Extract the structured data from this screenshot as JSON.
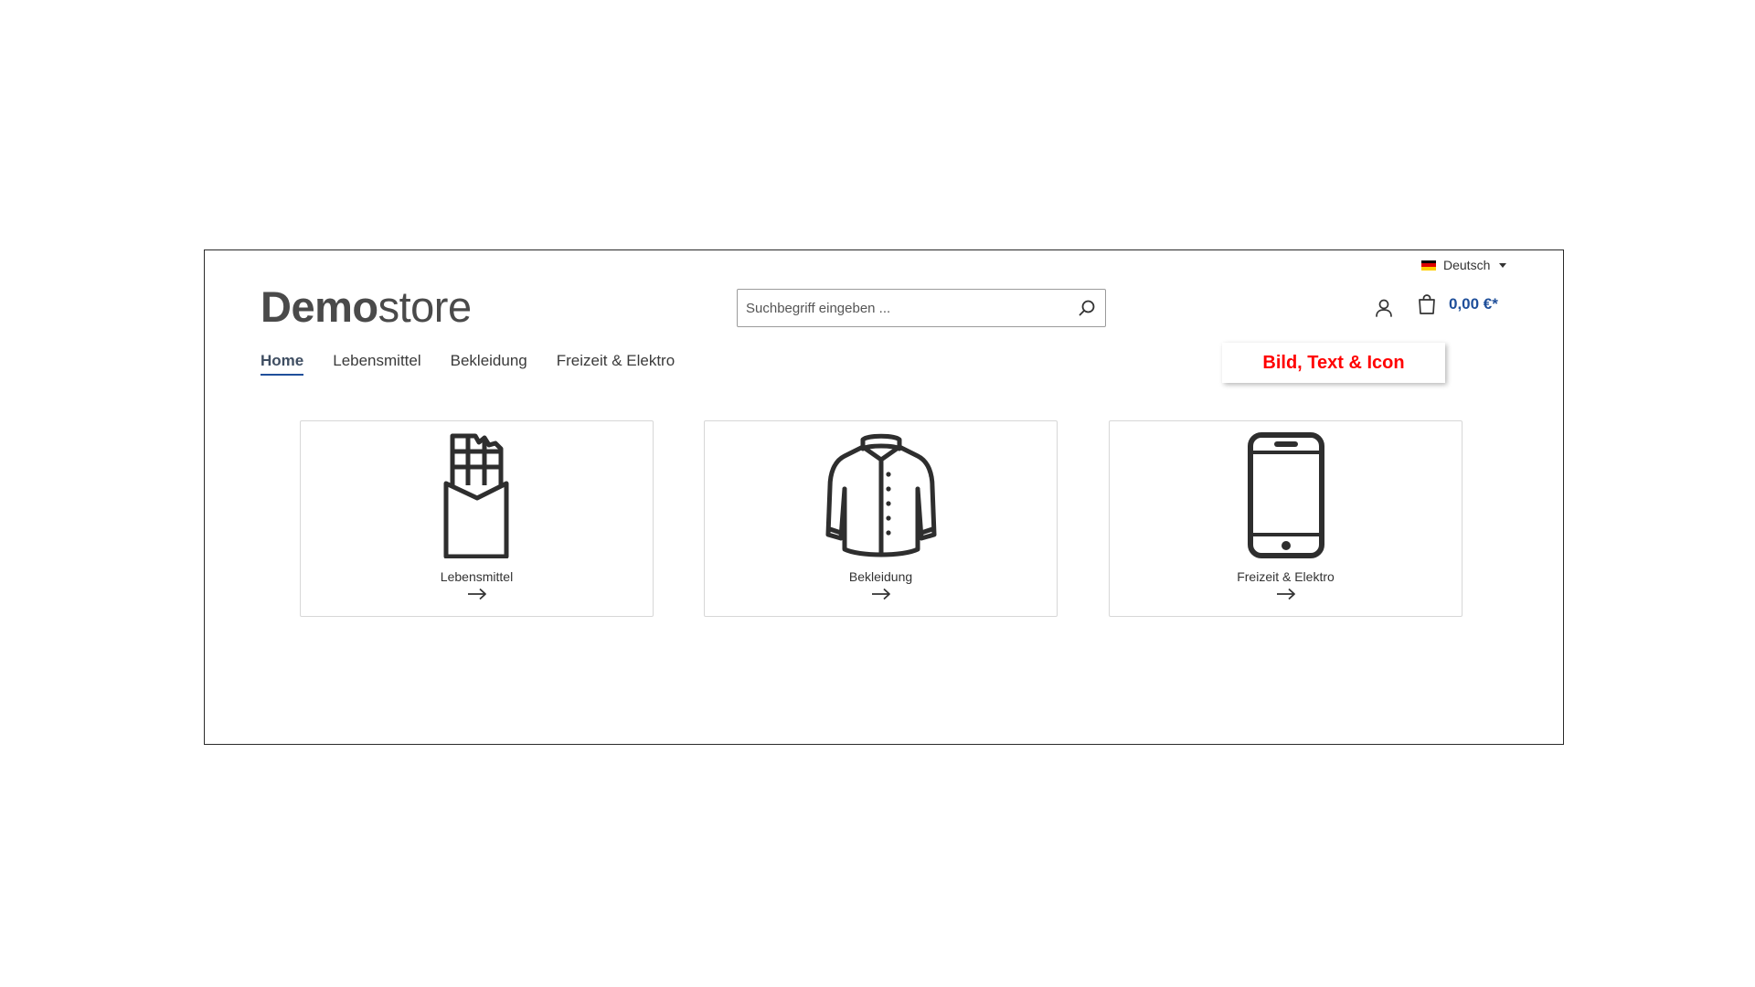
{
  "header": {
    "language": {
      "label": "Deutsch",
      "flag_colors": [
        "#000000",
        "#dd0000",
        "#ffce00"
      ]
    },
    "logo": {
      "bold": "Demo",
      "light": "store"
    },
    "search": {
      "placeholder": "Suchbegriff eingeben ..."
    },
    "cart": {
      "total": "0,00 €*"
    }
  },
  "nav": {
    "items": [
      {
        "label": "Home",
        "active": true
      },
      {
        "label": "Lebensmittel",
        "active": false
      },
      {
        "label": "Bekleidung",
        "active": false
      },
      {
        "label": "Freizeit & Elektro",
        "active": false
      }
    ]
  },
  "annotation": {
    "text": "Bild, Text & Icon",
    "color": "#ff0000"
  },
  "categories": [
    {
      "label": "Lebensmittel",
      "icon": "chocolate-bar-icon"
    },
    {
      "label": "Bekleidung",
      "icon": "jacket-icon"
    },
    {
      "label": "Freizeit & Elektro",
      "icon": "smartphone-icon"
    }
  ],
  "colors": {
    "accent": "#1f4f9a",
    "text": "#333333",
    "border": "#d7d7d7"
  }
}
